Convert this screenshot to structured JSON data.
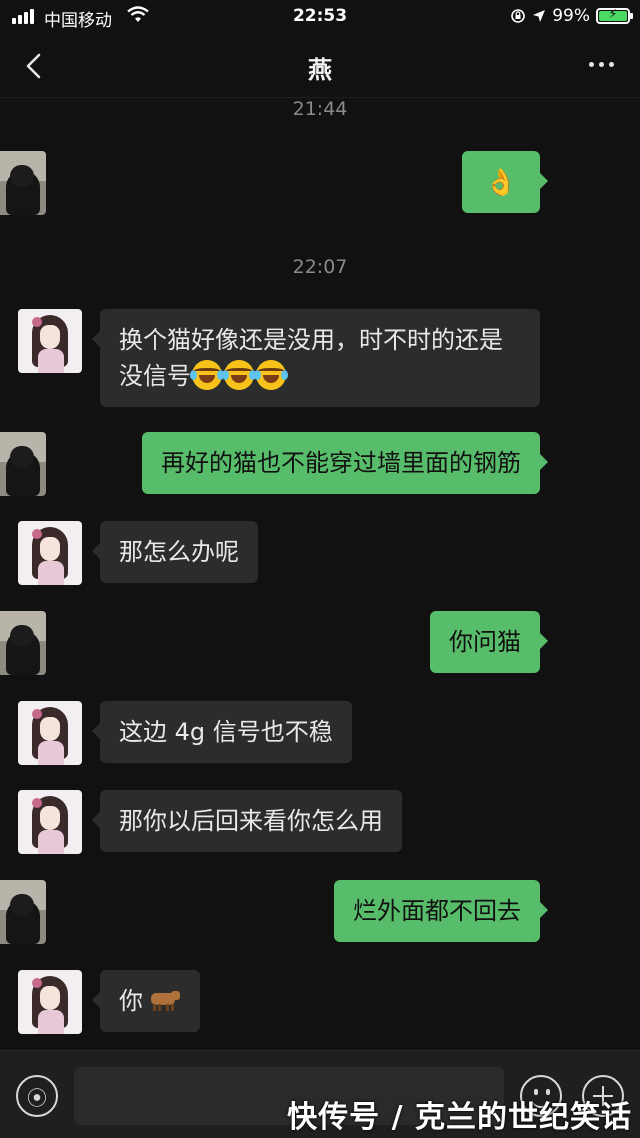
{
  "status_bar": {
    "carrier": "中国移动",
    "time": "22:53",
    "battery_percent": "99%",
    "battery_level": 0.99,
    "icons": [
      "signal-icon",
      "wifi-icon",
      "orientation-lock-icon",
      "location-icon",
      "battery-charging-icon"
    ]
  },
  "nav": {
    "title": "燕",
    "back_icon": "chevron-left-icon",
    "more_icon": "more-icon"
  },
  "timestamps": [
    "21:44",
    "22:07"
  ],
  "messages": [
    {
      "side": "right",
      "sender": "me",
      "text": "",
      "emoji": [
        "ok-hand"
      ]
    },
    {
      "side": "left",
      "sender": "燕",
      "text": "换个猫好像还是没用，时不时的还是没信号",
      "emoji": [
        "laughing-crying",
        "laughing-crying",
        "laughing-crying"
      ]
    },
    {
      "side": "right",
      "sender": "me",
      "text": "再好的猫也不能穿过墙里面的钢筋"
    },
    {
      "side": "left",
      "sender": "燕",
      "text": "那怎么办呢"
    },
    {
      "side": "right",
      "sender": "me",
      "text": "你问猫"
    },
    {
      "side": "left",
      "sender": "燕",
      "text": "这边 4g 信号也不稳"
    },
    {
      "side": "left",
      "sender": "燕",
      "text": "那你以后回来看你怎么用"
    },
    {
      "side": "right",
      "sender": "me",
      "text": "烂外面都不回去"
    },
    {
      "side": "left",
      "sender": "燕",
      "text": "你",
      "emoji": [
        "cow"
      ]
    }
  ],
  "input_bar": {
    "value": "",
    "icons": [
      "voice-icon",
      "emoji-icon",
      "plus-icon"
    ]
  },
  "watermark": "快传号 / 克兰的世纪笑话",
  "colors": {
    "background": "#111111",
    "incoming_bubble": "#2c2c2c",
    "outgoing_bubble": "#58bd6a",
    "timestamp": "#8a8a8a"
  }
}
